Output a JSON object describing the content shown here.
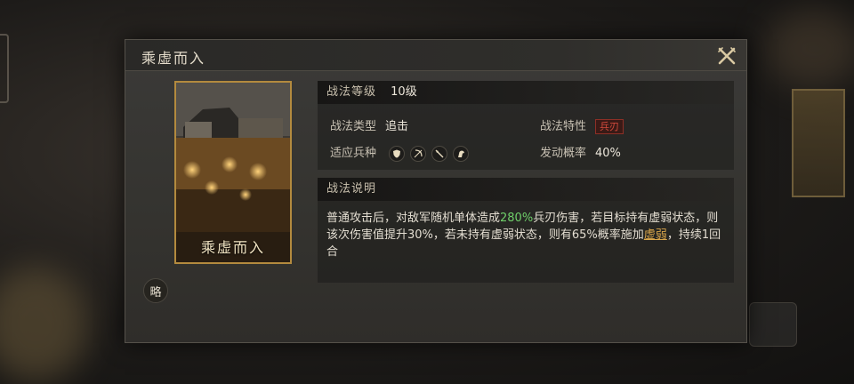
{
  "dialog": {
    "title": "乘虚而入"
  },
  "card": {
    "title": "乘虚而入",
    "strategy_button": "略"
  },
  "skill": {
    "level_label": "战法等级",
    "level_value": "10级",
    "type_label": "战法类型",
    "type_value": "追击",
    "trait_label": "战法特性",
    "trait_value": "兵刃",
    "troop_label": "适应兵种",
    "troop_icons": [
      "shield-icon",
      "bow-icon",
      "spear-icon",
      "horse-icon"
    ],
    "chance_label": "发动概率",
    "chance_value": "40%"
  },
  "description": {
    "title": "战法说明",
    "part1": "普通攻击后，对敌军随机单体造成",
    "highlight": "280%",
    "part2": "兵刃伤害，若目标持有虚弱状态，则该次伤害值提升30%，若未持有虚弱状态，则有65%概率施加",
    "link": "虚弱",
    "part3": "，持续1回合"
  },
  "colors": {
    "accent_gold": "#b38a3e",
    "highlight_green": "#6fcf6a",
    "link_gold": "#d9a54a",
    "trait_red": "#d0493c"
  }
}
